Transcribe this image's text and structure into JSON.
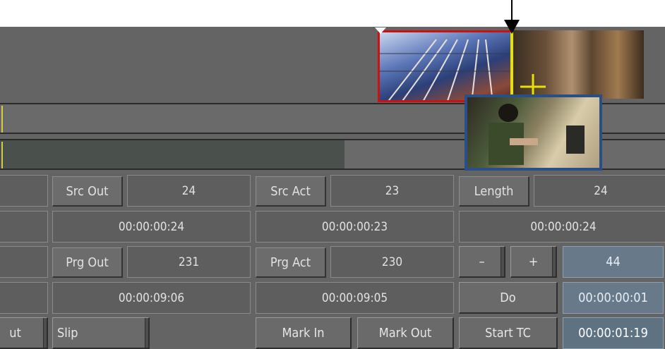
{
  "cells": {
    "src_out_label": "Src Out",
    "src_out_frames": "24",
    "src_out_tc": "00:00:00:24",
    "src_act_label": "Src Act",
    "src_act_frames": "23",
    "src_act_tc": "00:00:00:23",
    "length_label": "Length",
    "length_frames": "24",
    "length_tc": "00:00:00:24",
    "prg_out_label": "Prg Out",
    "prg_out_frames": "231",
    "prg_out_tc": "00:00:09:06",
    "prg_act_label": "Prg Act",
    "prg_act_frames": "230",
    "prg_act_tc": "00:00:09:05",
    "nudge_value": "44",
    "nudge_tc": "00:00:00:01",
    "start_tc_value": "00:00:01:19"
  },
  "buttons": {
    "minus": "–",
    "plus": "+",
    "do": "Do",
    "out_partial": "ut",
    "slip": "Slip",
    "mark_in": "Mark In",
    "mark_out": "Mark Out",
    "start_tc": "Start TC"
  },
  "colors": {
    "panel": "#646464",
    "cell": "#5e5e5e",
    "highlight_field": "#687a8a",
    "selected_clip_border": "#cc1111",
    "dragged_clip_border": "#2a4f86",
    "edit_marker": "#e8e000"
  }
}
